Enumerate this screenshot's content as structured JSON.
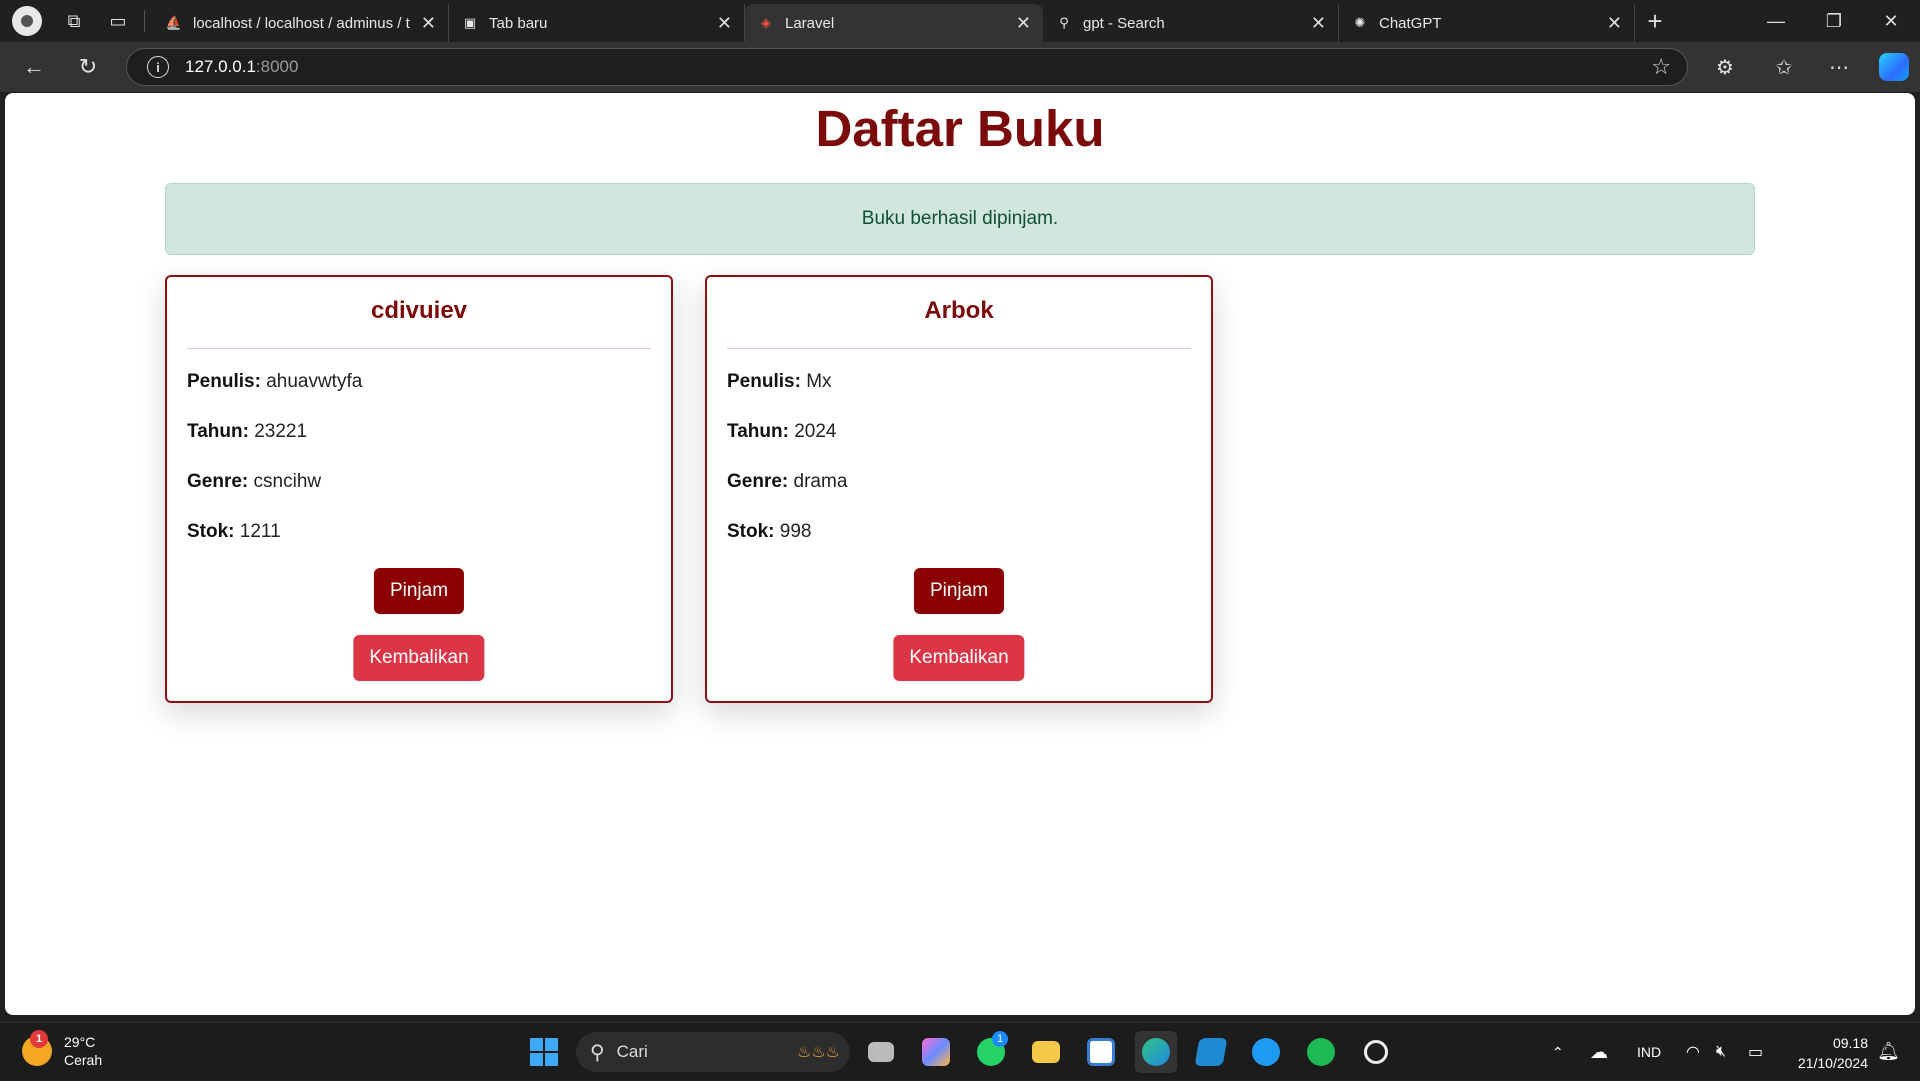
{
  "browser": {
    "tabs": [
      {
        "title": "localhost / localhost / adminus / t",
        "icon": "phpmyadmin-icon",
        "active": false
      },
      {
        "title": "Tab baru",
        "icon": "new-tab-icon",
        "active": false
      },
      {
        "title": "Laravel",
        "icon": "laravel-icon",
        "active": true
      },
      {
        "title": "gpt - Search",
        "icon": "search-icon",
        "active": false
      },
      {
        "title": "ChatGPT",
        "icon": "chatgpt-icon",
        "active": false
      }
    ],
    "url_host": "127.0.0.1",
    "url_port": ":8000"
  },
  "page": {
    "title": "Daftar Buku",
    "alert": "Buku berhasil dipinjam.",
    "labels": {
      "penulis": "Penulis:",
      "tahun": "Tahun:",
      "genre": "Genre:",
      "stok": "Stok:"
    },
    "books": [
      {
        "judul": "cdivuiev",
        "penulis": "ahuavwtyfa",
        "tahun": "23221",
        "genre": "csncihw",
        "stok": "1211",
        "pinjam": "Pinjam",
        "kembali": "Kembalikan"
      },
      {
        "judul": "Arbok",
        "penulis": "Mx",
        "tahun": "2024",
        "genre": "drama",
        "stok": "998",
        "pinjam": "Pinjam",
        "kembali": "Kembalikan"
      }
    ]
  },
  "taskbar": {
    "weather_temp": "29°C",
    "weather_desc": "Cerah",
    "weather_badge": "1",
    "search_label": "Cari",
    "whatsapp_badge": "1",
    "language": "IND",
    "time": "09.18",
    "date": "21/10/2024"
  },
  "colors": {
    "accent": "#7b0a0a",
    "pinjam": "#8b0000",
    "kembali": "#dc3545",
    "alert_bg": "#d1e7dd",
    "alert_text": "#0f5132"
  }
}
